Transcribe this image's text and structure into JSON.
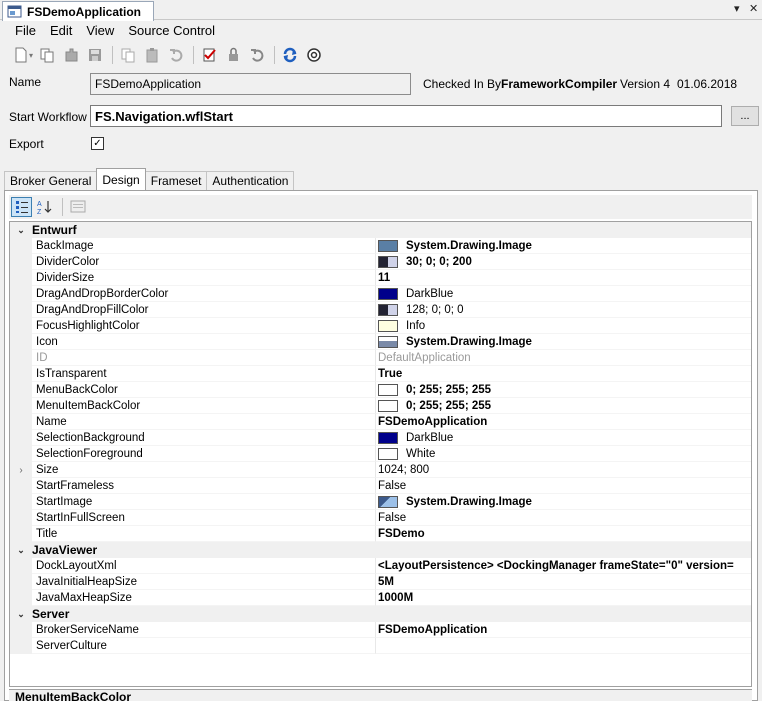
{
  "window": {
    "tab_title": "FSDemoApplication",
    "dropdown_glyph": "▾",
    "close_glyph": "✕"
  },
  "menu": [
    "File",
    "Edit",
    "View",
    "Source Control"
  ],
  "toolbar_icons": [
    "new-icon",
    "copy-icon",
    "paste-component-icon",
    "save-icon",
    "copy2-icon",
    "paste-icon",
    "undo-icon",
    "check-in-icon",
    "check-out-icon",
    "undo-checkout-icon",
    "refresh-icon",
    "settings-icon"
  ],
  "form": {
    "name_label": "Name",
    "name_value": "FSDemoApplication",
    "checked_in_label": "Checked In By",
    "checked_in_user": "FrameworkCompiler",
    "version": "Version 4",
    "date": "01.06.2018",
    "start_workflow_label": "Start Workflow",
    "start_workflow_value": "FS.Navigation.wflStart",
    "browse_label": "...",
    "export_label": "Export",
    "export_checked": true,
    "export_mark": "✓"
  },
  "tabs": [
    {
      "label": "Broker General",
      "active": false
    },
    {
      "label": "Design",
      "active": true
    },
    {
      "label": "Frameset",
      "active": false
    },
    {
      "label": "Authentication",
      "active": false
    }
  ],
  "property_grid": {
    "categories": [
      {
        "name": "Entwurf",
        "rows": [
          {
            "name": "BackImage",
            "value": "System.Drawing.Image",
            "bold": true,
            "swatch": "#5a7fa5"
          },
          {
            "name": "DividerColor",
            "value": "30; 0; 0; 200",
            "bold": true,
            "swatch": "pattern"
          },
          {
            "name": "DividerSize",
            "value": "11",
            "bold": true
          },
          {
            "name": "DragAndDropBorderColor",
            "value": "DarkBlue",
            "bold": false,
            "swatch": "#00008b"
          },
          {
            "name": "DragAndDropFillColor",
            "value": "128; 0; 0; 0",
            "bold": false,
            "swatch": "pattern"
          },
          {
            "name": "FocusHighlightColor",
            "value": "Info",
            "bold": false,
            "swatch": "#ffffe1"
          },
          {
            "name": "Icon",
            "value": "System.Drawing.Image",
            "bold": true,
            "swatch": "icon"
          },
          {
            "name": "ID",
            "value": "DefaultApplication",
            "bold": false,
            "dim": true
          },
          {
            "name": "IsTransparent",
            "value": "True",
            "bold": true
          },
          {
            "name": "MenuBackColor",
            "value": "0; 255; 255; 255",
            "bold": true,
            "swatch": "#ffffff"
          },
          {
            "name": "MenuItemBackColor",
            "value": "0; 255; 255; 255",
            "bold": true,
            "swatch": "#ffffff"
          },
          {
            "name": "Name",
            "value": "FSDemoApplication",
            "bold": true
          },
          {
            "name": "SelectionBackground",
            "value": "DarkBlue",
            "bold": false,
            "swatch": "#00008b"
          },
          {
            "name": "SelectionForeground",
            "value": "White",
            "bold": false,
            "swatch": "#ffffff"
          },
          {
            "name": "Size",
            "value": "1024; 800",
            "bold": false,
            "expandable": true
          },
          {
            "name": "StartFrameless",
            "value": "False",
            "bold": false
          },
          {
            "name": "StartImage",
            "value": "System.Drawing.Image",
            "bold": true,
            "swatch": "image"
          },
          {
            "name": "StartInFullScreen",
            "value": "False",
            "bold": false
          },
          {
            "name": "Title",
            "value": "FSDemo",
            "bold": true
          }
        ]
      },
      {
        "name": "JavaViewer",
        "rows": [
          {
            "name": "DockLayoutXml",
            "value": "<LayoutPersistence>  <DockingManager frameState=\"0\" version=",
            "bold": true
          },
          {
            "name": "JavaInitialHeapSize",
            "value": "5M",
            "bold": true
          },
          {
            "name": "JavaMaxHeapSize",
            "value": "1000M",
            "bold": true
          }
        ]
      },
      {
        "name": "Server",
        "rows": [
          {
            "name": "BrokerServiceName",
            "value": "FSDemoApplication",
            "bold": true
          },
          {
            "name": "ServerCulture",
            "value": "",
            "bold": false
          }
        ]
      }
    ],
    "description_title": "MenuItemBackColor"
  }
}
